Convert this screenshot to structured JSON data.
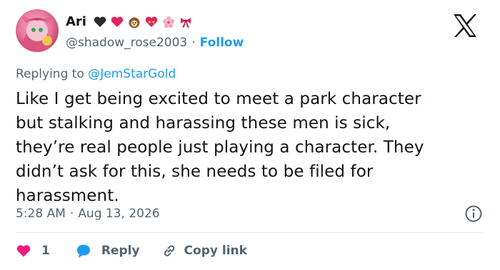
{
  "user": {
    "display_name": "Ari",
    "handle": "@shadow_rose2003",
    "separator": "·",
    "follow_label": "Follow",
    "name_emojis": [
      "black-heart",
      "red-heart",
      "hedgehog",
      "heart-with-ribbon",
      "cherry-blossom",
      "ribbon"
    ]
  },
  "reply_context": {
    "prefix": "Replying to",
    "mention": "@JemStarGold"
  },
  "tweet": {
    "lines": [
      "Like I get being excited to meet a park character",
      "but stalking and harassing these men is sick,",
      "they’re real people just playing a character. They",
      "didn’t ask for this, she needs to be filed for",
      "harassment."
    ],
    "time": "5:28 AM",
    "separator": "·",
    "date": "Aug 13, 2026"
  },
  "actions": {
    "like_count": "1",
    "reply_label": "Reply",
    "copy_label": "Copy link"
  },
  "colors": {
    "accent": "#1d9bf0",
    "like": "#f91880",
    "muted": "#536471",
    "text": "#0f1419"
  },
  "icons": [
    "x-logo-icon",
    "info-icon",
    "heart-icon",
    "reply-bubble-icon",
    "link-icon"
  ]
}
